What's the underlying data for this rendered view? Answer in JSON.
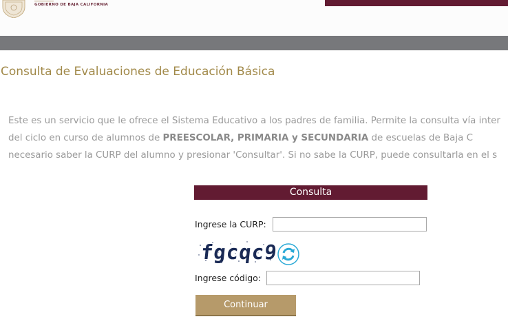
{
  "header": {
    "logo_text": "GOBIERNO DE BAJA CALIFORNIA",
    "colors": {
      "maroon": "#621b32",
      "gold": "#a18949",
      "gray_bar": "#77787b"
    }
  },
  "page": {
    "title": "Consulta de Evaluaciones de Educación Básica"
  },
  "intro": {
    "line1": "Este es un servicio que le ofrece el Sistema Educativo a los padres de familia. Permite la consulta vía inter",
    "line2_a": "del ciclo en curso de alumnos de ",
    "line2_bold": "PREESCOLAR, PRIMARIA y SECUNDARIA",
    "line2_b": " de escuelas de Baja C",
    "line3": "necesario saber la CURP del alumno y presionar 'Consultar'. Si no sabe la CURP, puede consultarla en el s"
  },
  "form": {
    "section_title": "Consulta",
    "curp_label": "Ingrese la CURP:",
    "curp_value": "",
    "captcha_text": "fgcqc9",
    "refresh_icon": "refresh-arrows-icon",
    "code_label": "Ingrese código:",
    "code_value": "",
    "continue_label": "Continuar"
  }
}
